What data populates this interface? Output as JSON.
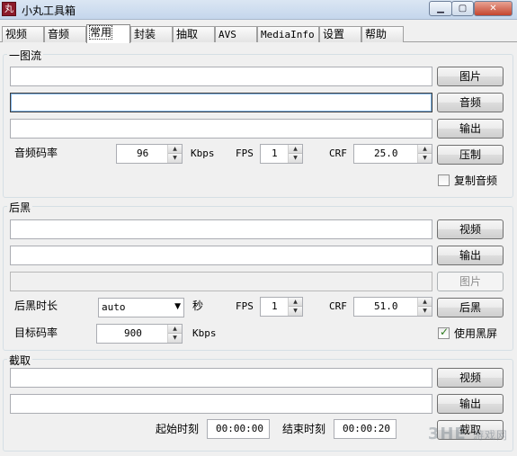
{
  "window": {
    "title": "小丸工具箱",
    "icon_glyph": "丸",
    "minimize": "▁",
    "maximize": "▢",
    "close": "✕"
  },
  "tabs": [
    "视频",
    "音频",
    "常用",
    "封装",
    "抽取",
    "AVS",
    "MediaInfo",
    "设置",
    "帮助"
  ],
  "active_tab": "常用",
  "one_pic": {
    "title": "一图流",
    "image_button": "图片",
    "audio_button": "音频",
    "output_button": "输出",
    "compress_button": "压制",
    "audio_bitrate_label": "音频码率",
    "audio_bitrate_value": "96",
    "kbps_label": "Kbps",
    "fps_label": "FPS",
    "fps_value": "1",
    "crf_label": "CRF",
    "crf_value": "25.0",
    "copy_audio_label": "复制音频"
  },
  "black_tail": {
    "title": "后黑",
    "video_button": "视频",
    "output_button": "输出",
    "image_button": "图片",
    "duration_label": "后黑时长",
    "duration_value": "auto",
    "seconds_label": "秒",
    "fps_label": "FPS",
    "fps_value": "1",
    "crf_label": "CRF",
    "crf_value": "51.0",
    "run_button": "后黑",
    "target_bitrate_label": "目标码率",
    "target_bitrate_value": "900",
    "kbps_label": "Kbps",
    "use_black_label": "使用黑屏",
    "use_black_checked": "✓"
  },
  "cut": {
    "title": "截取",
    "video_button": "视频",
    "output_button": "输出",
    "start_label": "起始时刻",
    "start_value": "00:00:00",
    "end_label": "结束时刻",
    "end_value": "00:00:20",
    "cut_button": "截取"
  },
  "watermark": {
    "logo": "3HE",
    "text": "游戏网"
  }
}
